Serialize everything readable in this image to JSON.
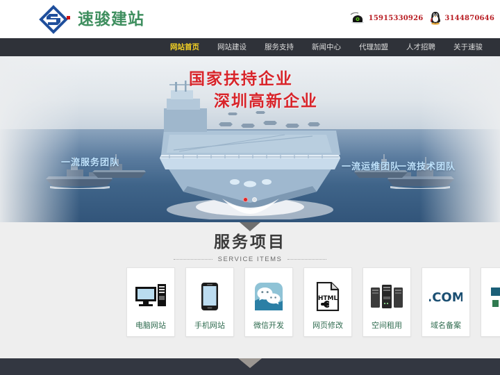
{
  "header": {
    "logo_text": "速骏建站",
    "logo_mark_name": "suju-diamond-logo",
    "contacts": [
      {
        "icon": "telephone-icon",
        "number": "15915330926"
      },
      {
        "icon": "qq-penguin-icon",
        "number": "3144870646"
      }
    ]
  },
  "nav": {
    "items": [
      {
        "label": "网站首页",
        "active": true
      },
      {
        "label": "网站建设",
        "active": false
      },
      {
        "label": "服务支持",
        "active": false
      },
      {
        "label": "新闻中心",
        "active": false
      },
      {
        "label": "代理加盟",
        "active": false
      },
      {
        "label": "人才招聘",
        "active": false
      },
      {
        "label": "关于速骏",
        "active": false
      }
    ]
  },
  "banner": {
    "headline_1": "国家扶持企业",
    "headline_2": "深圳高新企业",
    "tag_left": "一流服务团队",
    "tag_right_1": "一流运维团队",
    "tag_right_2": "一流技术团队",
    "slides": [
      {
        "name": "slide-1",
        "active": true
      },
      {
        "name": "slide-2",
        "active": false
      }
    ]
  },
  "services": {
    "title": "服务项目",
    "subtitle": "SERVICE ITEMS",
    "cards": [
      {
        "label": "电脑网站",
        "icon": "desktop-computer-icon"
      },
      {
        "label": "手机网站",
        "icon": "smartphone-icon"
      },
      {
        "label": "微信开发",
        "icon": "wechat-icon"
      },
      {
        "label": "网页修改",
        "icon": "html-file-wrench-icon"
      },
      {
        "label": "空间租用",
        "icon": "server-rack-icon"
      },
      {
        "label": "域名备案",
        "icon": "dot-com-icon"
      },
      {
        "label": "",
        "icon": "partial-card-icon"
      }
    ]
  },
  "footer": {
    "arrow_name": "scroll-down-arrow"
  },
  "colors": {
    "nav_bg": "#2f3239",
    "nav_active": "#f2d024",
    "logo_green": "#3f8f5f",
    "logo_blue": "#1f4f9c",
    "accent_red": "#d8242a",
    "contact_red": "#b81c22",
    "section_bg": "#eeeeee",
    "card_label": "#2f6b4f",
    "footer_bg": "#333741"
  }
}
